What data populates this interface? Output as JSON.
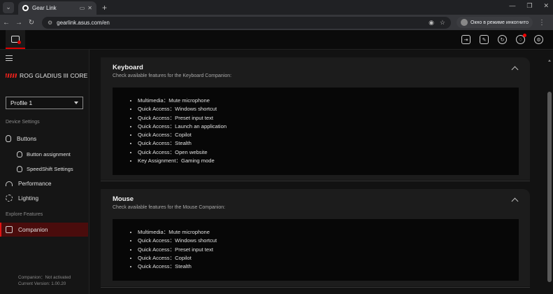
{
  "browser": {
    "tab_title": "Gear Link",
    "url": "gearlink.asus.com/en",
    "incognito_label": "Окно в режиме инкогнито"
  },
  "sidebar": {
    "device_name": "ROG GLADIUS III CORE",
    "profile_selected": "Profile 1",
    "device_settings_label": "Device Settings",
    "explore_label": "Explore Features",
    "items": {
      "buttons": "Buttons",
      "button_assignment": "Button assignment",
      "speedshift": "SpeedShift Settings",
      "performance": "Performance",
      "lighting": "Lighting",
      "companion": "Companion"
    },
    "status_companion": "Companion：Not activated",
    "status_version": "Current Version: 1.00.20"
  },
  "keyboard": {
    "title": "Keyboard",
    "description": "Check available features for the Keyboard Companion:",
    "features": [
      "Multimedia：Mute microphone",
      "Quick Access：Windows shortcut",
      "Quick Access：Preset input text",
      "Quick Access：Launch an application",
      "Quick Access：Copilot",
      "Quick Access：Stealth",
      "Quick Access：Open website",
      "Key Assignment：Gaming mode"
    ]
  },
  "mouse": {
    "title": "Mouse",
    "description": "Check available features for the Mouse Companion:",
    "features": [
      "Multimedia：Mute microphone",
      "Quick Access：Windows shortcut",
      "Quick Access：Preset input text",
      "Quick Access：Copilot",
      "Quick Access：Stealth"
    ]
  },
  "colors": {
    "accent": "#e01515",
    "active_bg": "#4a0c0c"
  }
}
